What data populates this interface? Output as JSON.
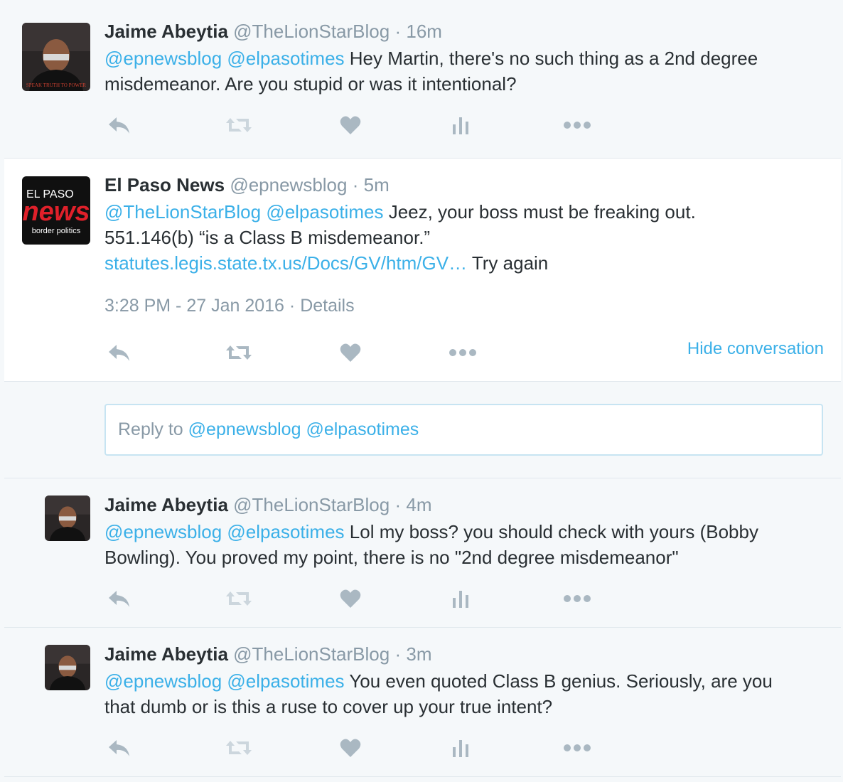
{
  "tweets": [
    {
      "name": "Jaime Abeytia",
      "handle": "@TheLionStarBlog",
      "time": "16m",
      "mention1": "@epnewsblog",
      "mention2": "@elpasotimes",
      "text_line1": "Hey Martin, there's no such thing as a 2nd degree",
      "text_line2": "misdemeanor. Are you stupid or was it intentional?"
    },
    {
      "name": "El Paso News",
      "handle": "@epnewsblog",
      "time": "5m",
      "mention1": "@TheLionStarBlog",
      "mention2": "@elpasotimes",
      "text_line1": "Jeez, your boss must be freaking out.",
      "text_line2": "551.146(b) “is a Class B misdemeanor.”",
      "link": "statutes.legis.state.tx.us/Docs/GV/htm/GV…",
      "text_after_link": "Try again",
      "timestamp": "3:28 PM - 27 Jan 2016",
      "details": "Details",
      "hide_conversation": "Hide conversation",
      "avatar_text": {
        "line1": "EL PASO",
        "line2": "news",
        "line3": "border politics"
      }
    },
    {
      "name": "Jaime Abeytia",
      "handle": "@TheLionStarBlog",
      "time": "4m",
      "mention1": "@epnewsblog",
      "mention2": "@elpasotimes",
      "text_line1": "Lol my boss? you should check with yours (Bobby",
      "text_line2": "Bowling). You proved my point, there is no \"2nd degree misdemeanor\""
    },
    {
      "name": "Jaime Abeytia",
      "handle": "@TheLionStarBlog",
      "time": "3m",
      "mention1": "@epnewsblog",
      "mention2": "@elpasotimes",
      "text_line1": "You even quoted Class B genius. Seriously, are you",
      "text_line2": "that dumb or is this a ruse to cover up your true intent?"
    }
  ],
  "reply": {
    "prefix": "Reply to",
    "mention1": "@epnewsblog",
    "mention2": "@elpasotimes"
  },
  "jaime_avatar_caption": "SPEAK TRUTH TO POWER",
  "separator": "·",
  "colors": {
    "link": "#3bb0e8",
    "muted": "#8899a6",
    "icon": "#aab8c2",
    "icon_light": "#ccd6dd",
    "brand_red": "#e0202a"
  },
  "icons": [
    "reply-icon",
    "retweet-icon",
    "like-icon",
    "analytics-icon",
    "more-icon"
  ]
}
